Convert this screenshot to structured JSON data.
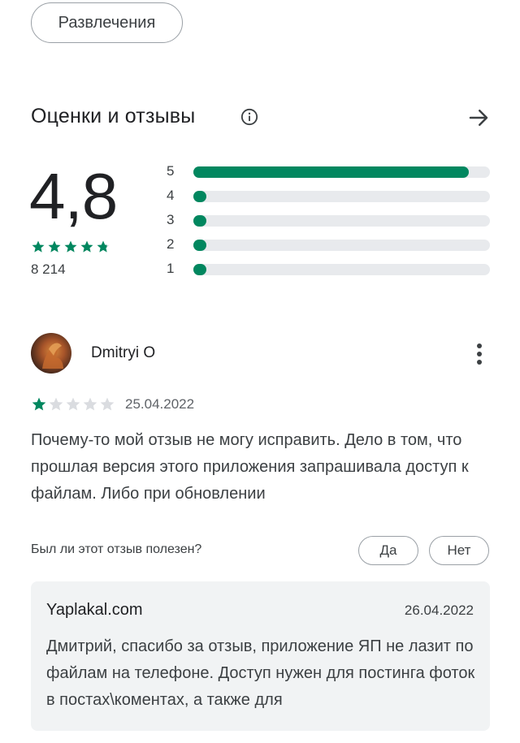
{
  "category_chip": "Развлечения",
  "ratings": {
    "title": "Оценки и отзывы",
    "score": "4,8",
    "stars": 4.8,
    "count": "8 214",
    "histogram": [
      {
        "label": "5",
        "fraction": 0.93
      },
      {
        "label": "4",
        "fraction": 0.02
      },
      {
        "label": "3",
        "fraction": 0.015
      },
      {
        "label": "2",
        "fraction": 0.015
      },
      {
        "label": "1",
        "fraction": 0.03
      }
    ],
    "accent_color": "#01875f"
  },
  "review": {
    "author": "Dmitryi O",
    "stars": 1,
    "date": "25.04.2022",
    "text": "Почему-то мой отзыв не могу исправить. Дело в том, что прошлая версия этого приложения запрашивала доступ к файлам. Либо при обновлении",
    "helpful_question": "Был ли этот отзыв полезен?",
    "yes_label": "Да",
    "no_label": "Нет"
  },
  "reply": {
    "author": "Yaplakal.com",
    "date": "26.04.2022",
    "text": "Дмитрий, спасибо за отзыв, приложение ЯП не лазит по файлам на телефоне. Доступ нужен для постинга фоток в постах\\коментах, а также для"
  },
  "icons": {
    "info": "info-icon",
    "arrow": "arrow-right-icon",
    "more": "more-vert-icon",
    "star": "star-icon"
  }
}
